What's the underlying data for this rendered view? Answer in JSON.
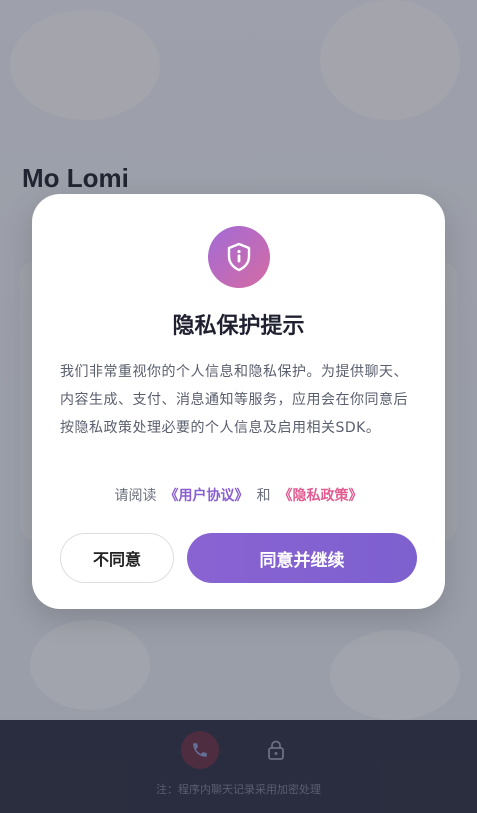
{
  "app": {
    "title": "Mo Lomi",
    "bottom_note": "注：程序内聊天记录采用加密处理"
  },
  "icons": {
    "shield": "shield-info-icon",
    "call": "phone-icon",
    "lock": "lock-icon"
  },
  "colors": {
    "accent": "#8a63d2",
    "privacy_link": "#e25c92",
    "terms_link": "#8a5fd0"
  },
  "dialog": {
    "title": "隐私保护提示",
    "body": "我们非常重视你的个人信息和隐私保护。为提供聊天、内容生成、支付、消息通知等服务，应用会在你同意后按隐私政策处理必要的个人信息及启用相关SDK。",
    "consent_prefix": "请阅读",
    "terms_link": "《用户协议》",
    "consent_and": "和",
    "privacy_link": "《隐私政策》",
    "disagree_label": "不同意",
    "agree_label": "同意并继续"
  }
}
